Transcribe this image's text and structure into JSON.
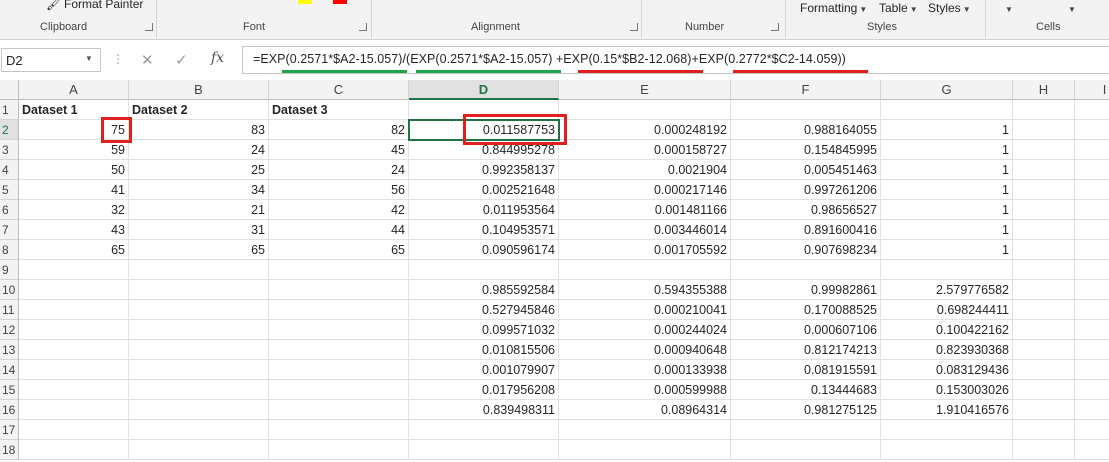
{
  "ribbon": {
    "format_painter": "Format Painter",
    "formatting": "Formatting",
    "table": "Table",
    "styles_btn": "Styles",
    "groups": {
      "clipboard": "Clipboard",
      "font": "Font",
      "alignment": "Alignment",
      "number": "Number",
      "styles": "Styles",
      "cells": "Cells"
    }
  },
  "formula_bar": {
    "name_box": "D2",
    "formula": "=EXP(0.2571*$A2-15.057)/(EXP(0.2571*$A2-15.057) +EXP(0.15*$B2-12.068)+EXP(0.2772*$C2-14.059))",
    "fx_symbol": "fx",
    "cancel_symbol": "✕",
    "enter_symbol": "✓",
    "underline_colors": {
      "numerator": "#1fa64a",
      "denominator_first": "#1fa64a",
      "term_b": "#e02020",
      "term_c": "#e02020"
    }
  },
  "sheet": {
    "columns": [
      "A",
      "B",
      "C",
      "D",
      "E",
      "F",
      "G",
      "H",
      "I"
    ],
    "rows": [
      [
        "Dataset 1",
        "Dataset 2",
        "Dataset 3",
        "",
        "",
        "",
        "",
        "",
        ""
      ],
      [
        "75",
        "83",
        "82",
        "0.011587753",
        "0.000248192",
        "0.988164055",
        "1",
        "",
        ""
      ],
      [
        "59",
        "24",
        "45",
        "0.844995278",
        "0.000158727",
        "0.154845995",
        "1",
        "",
        ""
      ],
      [
        "50",
        "25",
        "24",
        "0.992358137",
        "0.0021904",
        "0.005451463",
        "1",
        "",
        ""
      ],
      [
        "41",
        "34",
        "56",
        "0.002521648",
        "0.000217146",
        "0.997261206",
        "1",
        "",
        ""
      ],
      [
        "32",
        "21",
        "42",
        "0.011953564",
        "0.001481166",
        "0.98656527",
        "1",
        "",
        ""
      ],
      [
        "43",
        "31",
        "44",
        "0.104953571",
        "0.003446014",
        "0.891600416",
        "1",
        "",
        ""
      ],
      [
        "65",
        "65",
        "65",
        "0.090596174",
        "0.001705592",
        "0.907698234",
        "1",
        "",
        ""
      ],
      [
        "",
        "",
        "",
        "",
        "",
        "",
        "",
        "",
        ""
      ],
      [
        "",
        "",
        "",
        "0.985592584",
        "0.594355388",
        "0.99982861",
        "2.579776582",
        "",
        ""
      ],
      [
        "",
        "",
        "",
        "0.527945846",
        "0.000210041",
        "0.170088525",
        "0.698244411",
        "",
        ""
      ],
      [
        "",
        "",
        "",
        "0.099571032",
        "0.000244024",
        "0.000607106",
        "0.100422162",
        "",
        ""
      ],
      [
        "",
        "",
        "",
        "0.010815506",
        "0.000940648",
        "0.812174213",
        "0.823930368",
        "",
        ""
      ],
      [
        "",
        "",
        "",
        "0.001079907",
        "0.000133938",
        "0.081915591",
        "0.083129436",
        "",
        ""
      ],
      [
        "",
        "",
        "",
        "0.017956208",
        "0.000599988",
        "0.13444683",
        "0.153003026",
        "",
        ""
      ],
      [
        "",
        "",
        "",
        "0.839498311",
        "0.08964314",
        "0.981275125",
        "1.910416576",
        "",
        ""
      ],
      [
        "",
        "",
        "",
        "",
        "",
        "",
        "",
        "",
        ""
      ],
      [
        "",
        "",
        "",
        "",
        "",
        "",
        "",
        "",
        ""
      ]
    ],
    "active_cell": "D2",
    "highlight_color": "#e02020",
    "accent_color": "#217346"
  }
}
